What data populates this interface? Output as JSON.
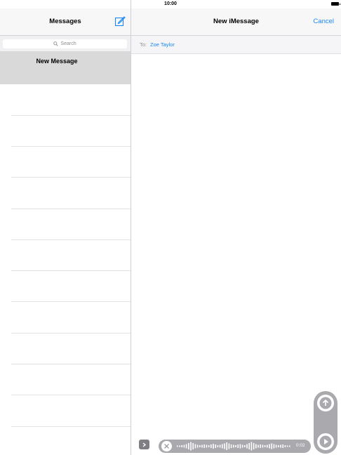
{
  "status_bar": {
    "time": "10:00",
    "signal_icon": "signal-dots-icon",
    "battery_icon": "battery-icon"
  },
  "sidebar": {
    "title": "Messages",
    "compose_icon": "compose-icon",
    "search": {
      "placeholder": "Search",
      "icon": "search-icon"
    },
    "selected_item": "New Message",
    "empty_rows": 12
  },
  "main": {
    "title": "New iMessage",
    "cancel_label": "Cancel",
    "to_label": "To:",
    "recipient": "Zoe Taylor"
  },
  "audio_recording": {
    "duration": "0:02",
    "discard_icon": "close-icon",
    "expand_icon": "chevron-right-icon",
    "send_icon": "send-arrow-up-icon",
    "play_icon": "play-icon"
  },
  "colors": {
    "accent": "#1a86f5",
    "control_gray": "#a9a9ae",
    "selected_row": "#d9d9d9"
  }
}
